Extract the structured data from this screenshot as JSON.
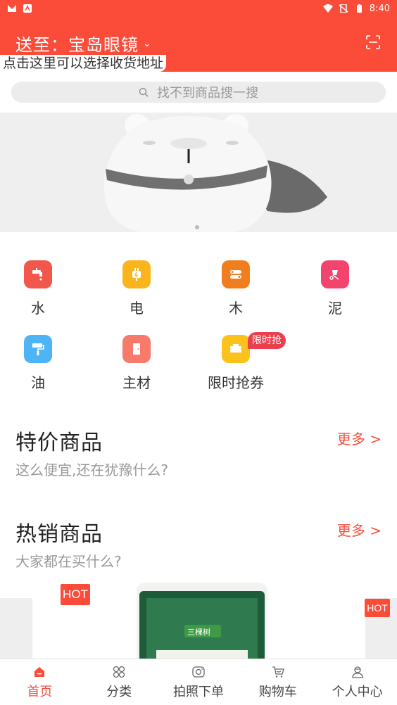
{
  "status_bar": {
    "time": "8:40"
  },
  "header": {
    "deliver_label": "送至：宝岛眼镜",
    "hint": "点击这里可以选择收货地址",
    "scan_icon": "scan-icon"
  },
  "search": {
    "placeholder": "找不到商品搜一搜"
  },
  "categories": [
    {
      "label": "水",
      "icon": "faucet-icon",
      "color": "#f2574c"
    },
    {
      "label": "电",
      "icon": "plug-icon",
      "color": "#fbb51c"
    },
    {
      "label": "木",
      "icon": "wood-icon",
      "color": "#f07e1e"
    },
    {
      "label": "泥",
      "icon": "cart-icon",
      "color": "#f2446d"
    },
    {
      "label": "油",
      "icon": "paint-roller-icon",
      "color": "#4db4f5"
    },
    {
      "label": "主材",
      "icon": "door-icon",
      "color": "#f77a6a"
    },
    {
      "label": "限时抢券",
      "icon": "coupon-icon",
      "color": "#fbc21b"
    }
  ],
  "flash_badge": "限时抢",
  "sections": {
    "special": {
      "title": "特价商品",
      "subtitle": "这么便宜,还在犹豫什么?",
      "more": "更多 >"
    },
    "hot": {
      "title": "热销商品",
      "subtitle": "大家都在买什么?",
      "more": "更多 >"
    }
  },
  "products": {
    "hot_tag": "HOT",
    "brand_label": "三棵树"
  },
  "tabs": [
    {
      "label": "首页",
      "icon": "home-icon",
      "active": true
    },
    {
      "label": "分类",
      "icon": "category-icon",
      "active": false
    },
    {
      "label": "拍照下单",
      "icon": "camera-icon",
      "active": false
    },
    {
      "label": "购物车",
      "icon": "cart-icon",
      "active": false
    },
    {
      "label": "个人中心",
      "icon": "user-icon",
      "active": false
    }
  ],
  "colors": {
    "brand": "#fb4c3a",
    "badge": "#ec3f4e"
  }
}
